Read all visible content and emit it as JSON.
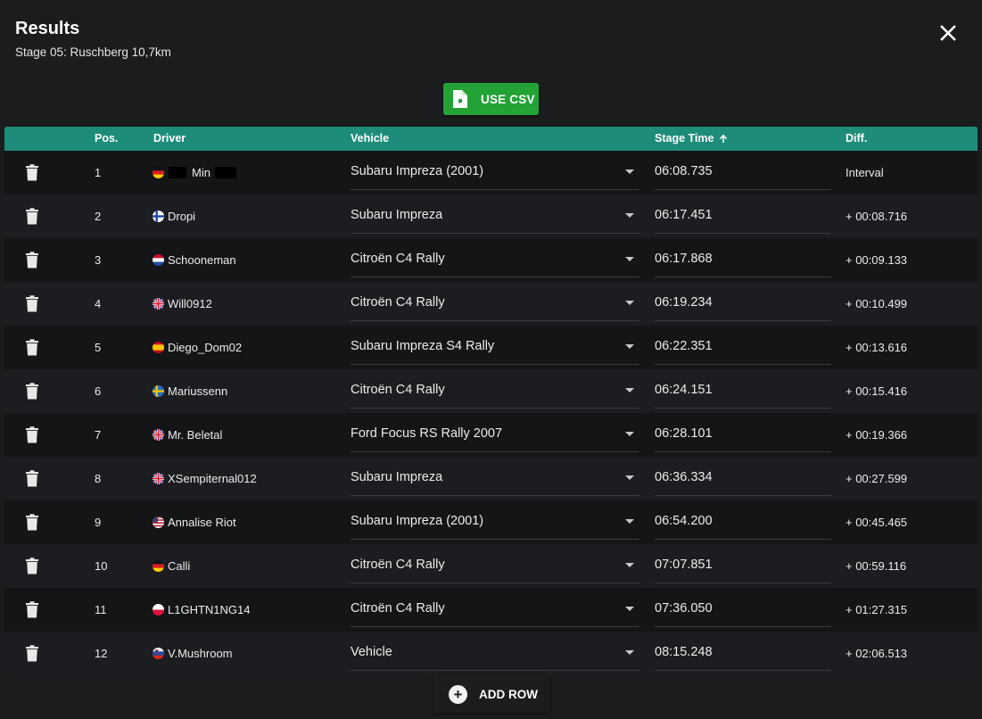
{
  "dialog": {
    "title": "Results",
    "subtitle": "Stage 05: Ruschberg 10,7km",
    "close_icon": "close-icon"
  },
  "toolbar": {
    "csv_label": "USE CSV",
    "csv_icon": "csv-file-icon",
    "csv_color": "#23a236"
  },
  "table": {
    "header_color": "#1d8c78",
    "columns": {
      "pos": "Pos.",
      "driver": "Driver",
      "vehicle": "Vehicle",
      "stage_time": "Stage Time",
      "diff": "Diff."
    },
    "sort": {
      "column": "stage_time",
      "direction": "ascending",
      "icon": "arrow-up-icon"
    },
    "rows": [
      {
        "pos": "1",
        "flag": "de",
        "driver": "Min",
        "vehicle": "Subaru Impreza (2001)",
        "time": "06:08.735",
        "diff": "Interval"
      },
      {
        "pos": "2",
        "flag": "fi",
        "driver": "Dropi",
        "vehicle": "Subaru Impreza",
        "time": "06:17.451",
        "diff": "+ 00:08.716"
      },
      {
        "pos": "3",
        "flag": "nl",
        "driver": "Schooneman",
        "vehicle": "Citroën C4 Rally",
        "time": "06:17.868",
        "diff": "+ 00:09.133"
      },
      {
        "pos": "4",
        "flag": "gb",
        "driver": "Will0912",
        "vehicle": "Citroën C4 Rally",
        "time": "06:19.234",
        "diff": "+ 00:10.499"
      },
      {
        "pos": "5",
        "flag": "es",
        "driver": "Diego_Dom02",
        "vehicle": "Subaru Impreza S4 Rally",
        "time": "06:22.351",
        "diff": "+ 00:13.616"
      },
      {
        "pos": "6",
        "flag": "se",
        "driver": "Mariussenn",
        "vehicle": "Citroën C4 Rally",
        "time": "06:24.151",
        "diff": "+ 00:15.416"
      },
      {
        "pos": "7",
        "flag": "gb",
        "driver": "Mr. Beletal",
        "vehicle": "Ford Focus RS Rally 2007",
        "time": "06:28.101",
        "diff": "+ 00:19.366"
      },
      {
        "pos": "8",
        "flag": "gb",
        "driver": "XSempiternal012",
        "vehicle": "Subaru Impreza",
        "time": "06:36.334",
        "diff": "+ 00:27.599"
      },
      {
        "pos": "9",
        "flag": "us",
        "driver": "Annalise Riot",
        "vehicle": "Subaru Impreza (2001)",
        "time": "06:54.200",
        "diff": "+ 00:45.465"
      },
      {
        "pos": "10",
        "flag": "de",
        "driver": "Calli",
        "vehicle": "Citroën C4 Rally",
        "time": "07:07.851",
        "diff": "+ 00:59.116"
      },
      {
        "pos": "11",
        "flag": "pl",
        "driver": "L1GHTN1NG14",
        "vehicle": "Citroën C4 Rally",
        "time": "07:36.050",
        "diff": "+ 01:27.315"
      },
      {
        "pos": "12",
        "flag": "si",
        "driver": "V.Mushroom",
        "vehicle": "Vehicle",
        "time": "08:15.248",
        "diff": "+ 02:06.513"
      }
    ]
  },
  "footer": {
    "add_row_label": "ADD ROW",
    "add_icon": "plus-circle-icon"
  }
}
